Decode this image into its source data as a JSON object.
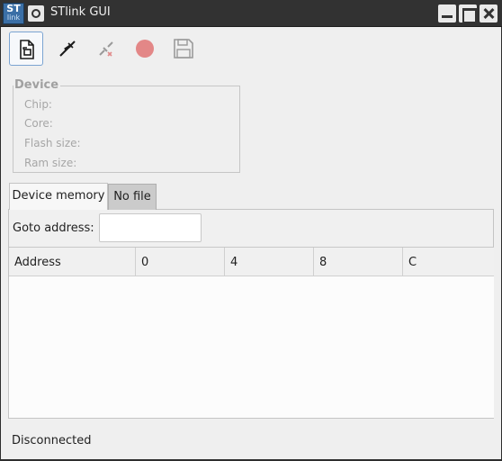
{
  "window": {
    "app_icon_top": "ST",
    "app_icon_bottom": "link",
    "title": "STlink GUI"
  },
  "toolbar": {
    "items": [
      {
        "name": "open-file",
        "icon": "file-open-icon"
      },
      {
        "name": "connect",
        "icon": "plug-connect-icon"
      },
      {
        "name": "disconnect",
        "icon": "plug-disconnect-icon"
      },
      {
        "name": "record",
        "icon": "red-circle-icon"
      },
      {
        "name": "save",
        "icon": "floppy-disk-icon"
      }
    ],
    "record_color": "#e38787"
  },
  "device": {
    "group_title": "Device",
    "chip_label": "Chip:",
    "core_label": "Core:",
    "flash_label": "Flash size:",
    "ram_label": "Ram size:"
  },
  "tabs": [
    {
      "label": "Device memory",
      "active": true
    },
    {
      "label": "No file",
      "active": false
    }
  ],
  "goto": {
    "label": "Goto address:",
    "value": ""
  },
  "memory_table": {
    "columns": [
      "Address",
      "0",
      "4",
      "8",
      "C"
    ],
    "rows": []
  },
  "status": {
    "text": "Disconnected"
  }
}
